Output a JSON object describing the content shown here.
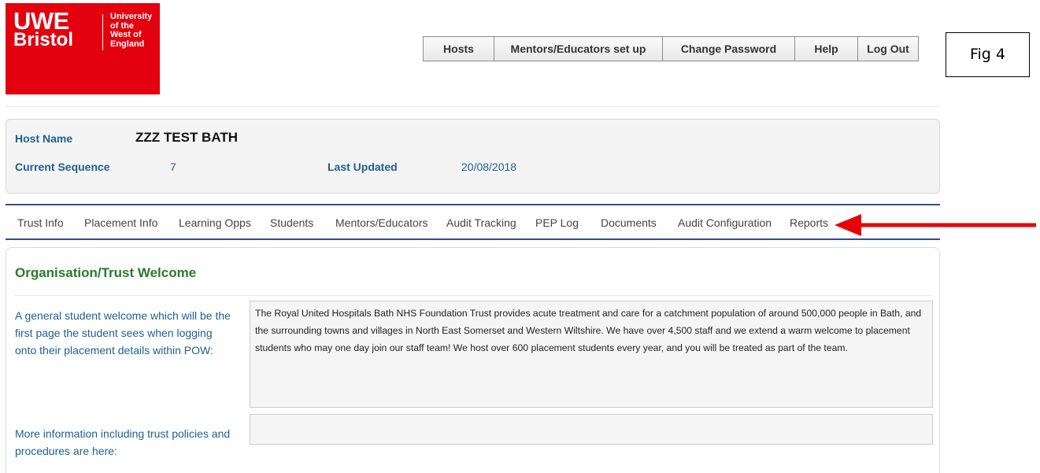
{
  "logo": {
    "line1": "UWE",
    "line2": "Bristol",
    "uni_lines": [
      "University",
      "of the",
      "West of",
      "England"
    ]
  },
  "topnav": {
    "items": [
      "Hosts",
      "Mentors/Educators set up",
      "Change Password",
      "Help",
      "Log Out"
    ]
  },
  "figure_label": "Fig 4",
  "host": {
    "name_label": "Host Name",
    "name_value": "ZZZ TEST BATH",
    "sequence_label": "Current Sequence",
    "sequence_value": "7",
    "updated_label": "Last Updated",
    "updated_value": "20/08/2018"
  },
  "tabs": [
    "Trust Info",
    "Placement Info",
    "Learning Opps",
    "Students",
    "Mentors/Educators",
    "Audit Tracking",
    "PEP Log",
    "Documents",
    "Audit Configuration",
    "Reports"
  ],
  "welcome": {
    "heading": "Organisation/Trust Welcome",
    "general_desc": "A general student welcome which will be the first page the student sees when logging onto their placement details within POW:",
    "general_text": "The Royal United Hospitals Bath NHS Foundation Trust provides acute treatment and care for a catchment population of around 500,000 people in Bath, and the surrounding towns and villages in North East Somerset and Western Wiltshire. We have over 4,500 staff and we extend a warm welcome to placement students who may one day join our staff team! We host over 600 placement students every year, and you will be treated as part of the team.",
    "more_desc": "More information including trust policies and procedures are here:",
    "more_text": ""
  },
  "colors": {
    "brand_red": "#e3000f",
    "label_blue": "#1f5f8f",
    "heading_green": "#2a7a2a",
    "tab_border": "#2f4e8f",
    "arrow_red": "#e8000b"
  }
}
